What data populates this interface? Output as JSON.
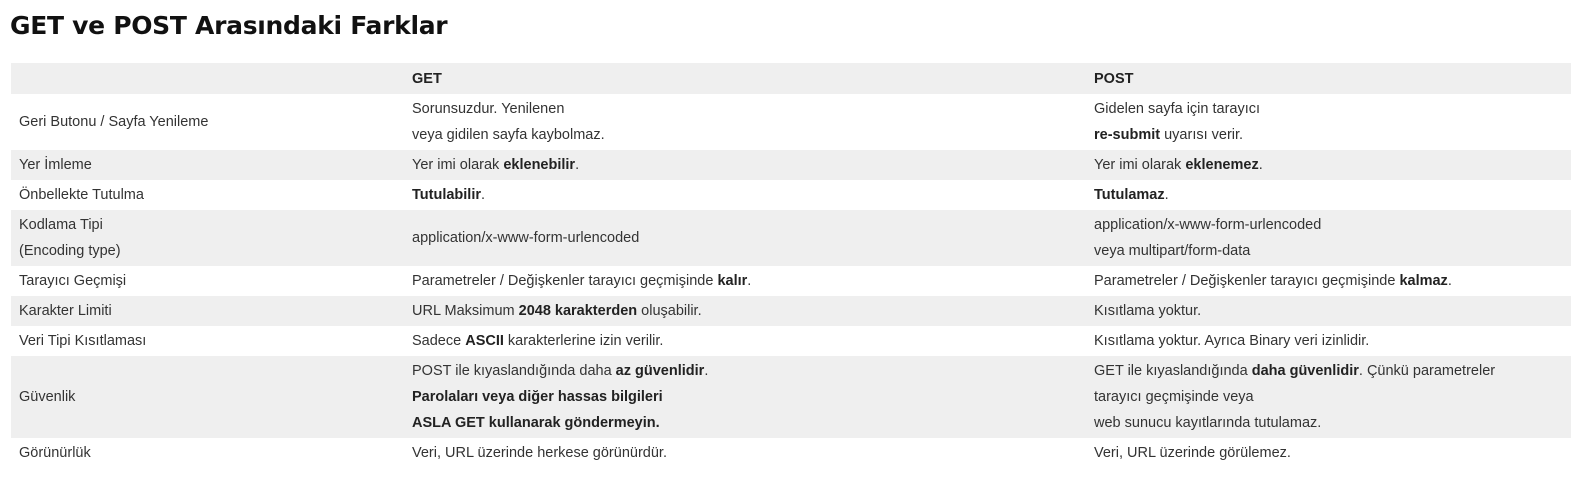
{
  "title": "GET ve POST Arasındaki Farklar",
  "header": {
    "col1": "",
    "col2": "GET",
    "col3": "POST"
  },
  "rows": [
    {
      "label": [
        "Geri Butonu / Sayfa Yenileme"
      ],
      "get": [
        [
          {
            "t": "Sorunsuzdur. Yenilenen"
          }
        ],
        [
          {
            "t": "veya gidilen sayfa kaybolmaz."
          }
        ]
      ],
      "post": [
        [
          {
            "t": "Gidelen sayfa için tarayıcı"
          }
        ],
        [
          {
            "t": "re-submit",
            "b": true
          },
          {
            "t": " uyarısı verir."
          }
        ]
      ]
    },
    {
      "label": [
        "Yer İmleme"
      ],
      "get": [
        [
          {
            "t": "Yer imi olarak "
          },
          {
            "t": "eklenebilir",
            "b": true
          },
          {
            "t": "."
          }
        ]
      ],
      "post": [
        [
          {
            "t": "Yer imi olarak "
          },
          {
            "t": "eklenemez",
            "b": true
          },
          {
            "t": "."
          }
        ]
      ]
    },
    {
      "label": [
        "Önbellekte Tutulma"
      ],
      "get": [
        [
          {
            "t": "Tutulabilir",
            "b": true
          },
          {
            "t": "."
          }
        ]
      ],
      "post": [
        [
          {
            "t": "Tutulamaz",
            "b": true
          },
          {
            "t": "."
          }
        ]
      ]
    },
    {
      "label": [
        "Kodlama Tipi",
        "(Encoding type)"
      ],
      "get": [
        [
          {
            "t": "application/x-www-form-urlencoded"
          }
        ]
      ],
      "post": [
        [
          {
            "t": "application/x-www-form-urlencoded"
          }
        ],
        [
          {
            "t": "veya  multipart/form-data"
          }
        ]
      ]
    },
    {
      "label": [
        "Tarayıcı Geçmişi"
      ],
      "get": [
        [
          {
            "t": "Parametreler / Değişkenler tarayıcı geçmişinde "
          },
          {
            "t": "kalır",
            "b": true
          },
          {
            "t": "."
          }
        ]
      ],
      "post": [
        [
          {
            "t": "Parametreler / Değişkenler tarayıcı geçmişinde "
          },
          {
            "t": "kalmaz",
            "b": true
          },
          {
            "t": "."
          }
        ]
      ]
    },
    {
      "label": [
        "Karakter Limiti"
      ],
      "get": [
        [
          {
            "t": "URL Maksimum "
          },
          {
            "t": "2048 karakterden",
            "b": true
          },
          {
            "t": " oluşabilir."
          }
        ]
      ],
      "post": [
        [
          {
            "t": "Kısıtlama yoktur."
          }
        ]
      ]
    },
    {
      "label": [
        "Veri Tipi Kısıtlaması"
      ],
      "get": [
        [
          {
            "t": "Sadece "
          },
          {
            "t": "ASCII",
            "b": true
          },
          {
            "t": " karakterlerine izin verilir."
          }
        ]
      ],
      "post": [
        [
          {
            "t": "Kısıtlama yoktur. Ayrıca Binary veri izinlidir."
          }
        ]
      ]
    },
    {
      "label": [
        "Güvenlik"
      ],
      "get": [
        [
          {
            "t": "POST ile kıyaslandığında daha "
          },
          {
            "t": "az güvenlidir",
            "b": true
          },
          {
            "t": "."
          }
        ],
        [
          {
            "t": "Parolaları veya diğer hassas bilgileri",
            "b": true
          }
        ],
        [
          {
            "t": "ASLA GET kullanarak göndermeyin.",
            "b": true
          }
        ]
      ],
      "post": [
        [
          {
            "t": "GET ile kıyaslandığında "
          },
          {
            "t": "daha güvenlidir",
            "b": true
          },
          {
            "t": ". Çünkü parametreler"
          }
        ],
        [
          {
            "t": "tarayıcı geçmişinde veya"
          }
        ],
        [
          {
            "t": "web sunucu kayıtlarında tutulamaz."
          }
        ]
      ]
    },
    {
      "label": [
        "Görünürlük"
      ],
      "get": [
        [
          {
            "t": "Veri, URL üzerinde herkese görünürdür."
          }
        ]
      ],
      "post": [
        [
          {
            "t": "Veri, URL üzerinde görülemez."
          }
        ]
      ]
    }
  ]
}
